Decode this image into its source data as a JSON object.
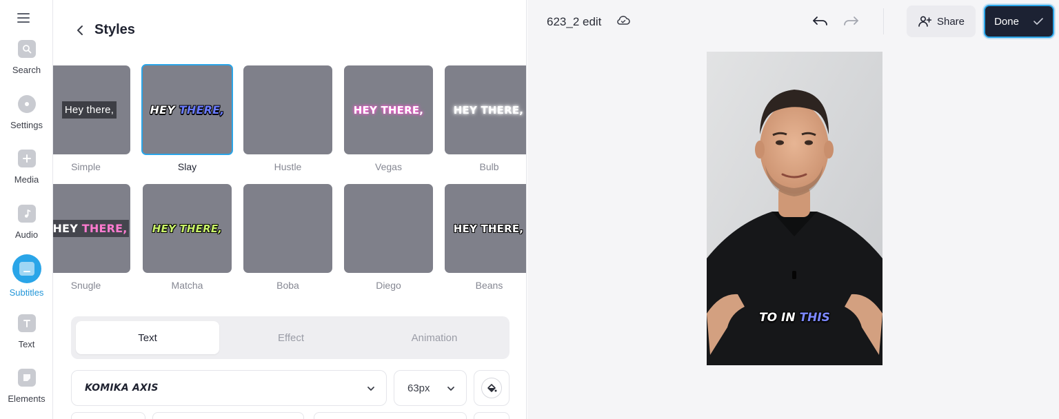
{
  "nav": {
    "items": [
      {
        "label": "Search",
        "icon": "search-icon"
      },
      {
        "label": "Settings",
        "icon": "gear-icon"
      },
      {
        "label": "Media",
        "icon": "plus-icon"
      },
      {
        "label": "Audio",
        "icon": "music-note-icon"
      },
      {
        "label": "Subtitles",
        "icon": "subtitles-icon",
        "active": true
      },
      {
        "label": "Text",
        "icon": "text-icon"
      },
      {
        "label": "Elements",
        "icon": "sticker-icon"
      }
    ]
  },
  "panel": {
    "title": "Styles",
    "styles": [
      {
        "name": "Simple",
        "preview": "Hey there,"
      },
      {
        "name": "Slay",
        "preview_main": "HEY ",
        "preview_highlight": "THERE,",
        "selected": true
      },
      {
        "name": "Hustle"
      },
      {
        "name": "Vegas",
        "preview": "HEY THERE,"
      },
      {
        "name": "Bulb",
        "preview": "HEY THERE,"
      },
      {
        "name": "Snugle",
        "preview_main": "HEY ",
        "preview_highlight": "THERE,"
      },
      {
        "name": "Matcha",
        "preview": "HEY THERE,"
      },
      {
        "name": "Boba"
      },
      {
        "name": "Diego"
      },
      {
        "name": "Beans",
        "preview": "HEY THERE,"
      }
    ],
    "tabs": [
      "Text",
      "Effect",
      "Animation"
    ],
    "active_tab": "Text",
    "font": "KOMIKA AXIS",
    "font_size": "63px"
  },
  "editor": {
    "doc_title": "623_2 edit",
    "share_label": "Share",
    "done_label": "Done",
    "caption_main": "TO IN ",
    "caption_highlight": "THIS"
  },
  "colors": {
    "accent": "#2aa5e8",
    "done_bg": "#1c2233",
    "tile_bg": "#7f808a",
    "highlight": "#6a7bff"
  }
}
